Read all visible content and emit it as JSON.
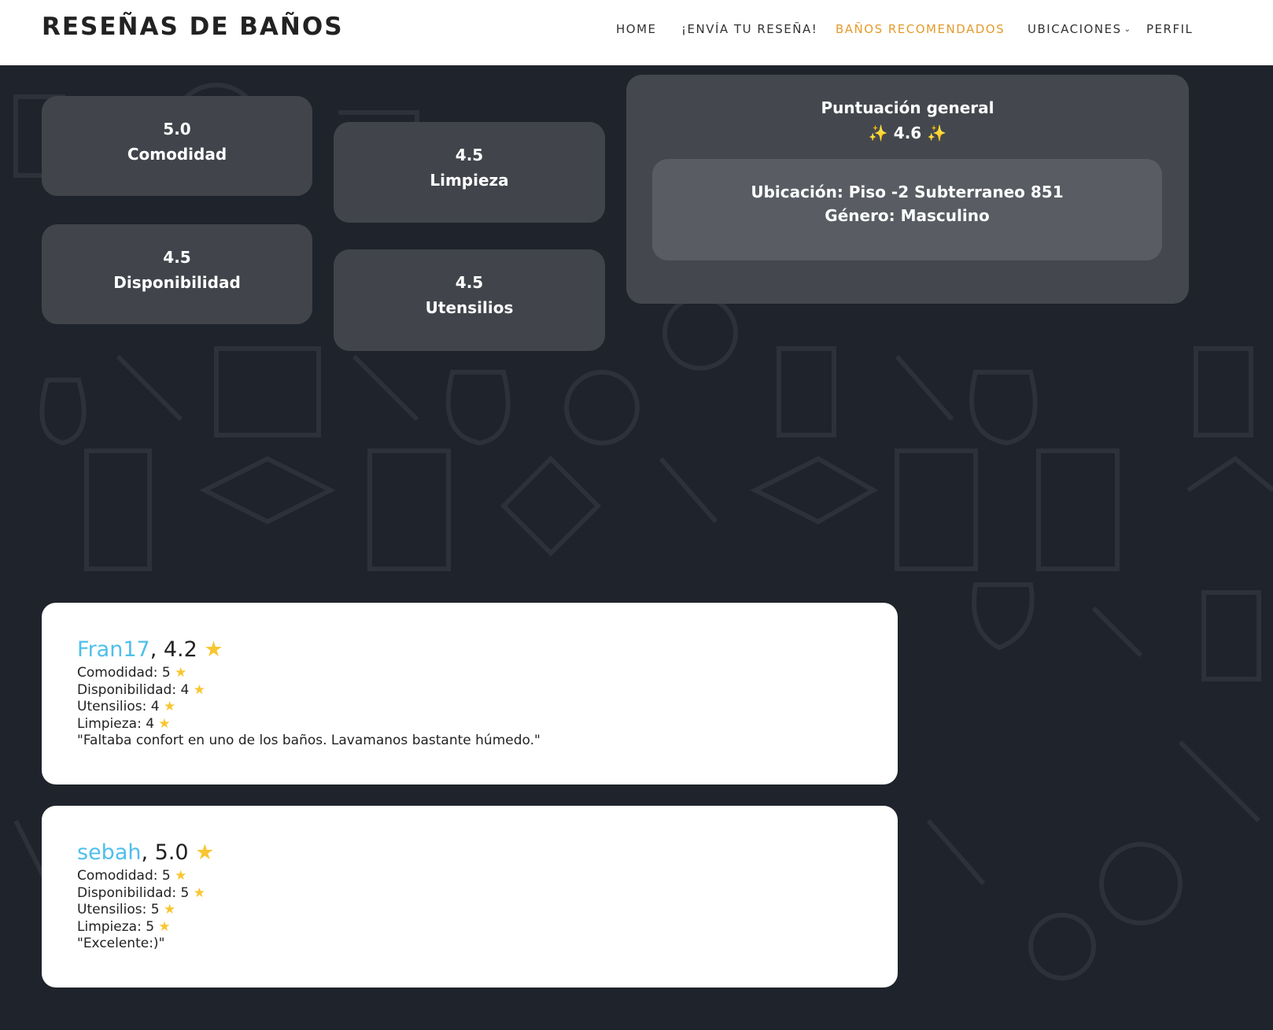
{
  "header": {
    "brand": "RESEÑAS DE BAÑOS",
    "nav": {
      "home": "HOME",
      "submit": "¡ENVÍA TU RESEÑA!",
      "recommended": "BAÑOS RECOMENDADOS",
      "locations": "UBICACIONES",
      "profile": "PERFIL"
    },
    "active_color": "#e49b2d"
  },
  "scores": {
    "comodidad": {
      "value": "5.0",
      "label": "Comodidad"
    },
    "limpieza": {
      "value": "4.5",
      "label": "Limpieza"
    },
    "disponibilidad": {
      "value": "4.5",
      "label": "Disponibilidad"
    },
    "utensilios": {
      "value": "4.5",
      "label": "Utensilios"
    }
  },
  "summary": {
    "title": "Puntuación general",
    "sparkle": "✨",
    "score": "4.6",
    "location": "Ubicación: Piso -2 Subterraneo 851",
    "gender": "Género: Masculino"
  },
  "reviews": [
    {
      "user": "Fran17",
      "rating": "4.2",
      "comodidad": "Comodidad: 5",
      "disponibilidad": "Disponibilidad: 4",
      "utensilios": "Utensilios: 4",
      "limpieza": "Limpieza: 4",
      "comment": "\"Faltaba confort en uno de los baños. Lavamanos bastante húmedo.\""
    },
    {
      "user": "sebah",
      "rating": "5.0",
      "comodidad": "Comodidad: 5",
      "disponibilidad": "Disponibilidad: 5",
      "utensilios": "Utensilios: 5",
      "limpieza": "Limpieza: 5",
      "comment": "\"Excelente:)\""
    }
  ],
  "icons": {
    "star": "star-icon",
    "chevron": "chevron-down-icon"
  },
  "colors": {
    "username": "#4fbfec",
    "star": "#f9c631",
    "background": "#1f232b"
  }
}
